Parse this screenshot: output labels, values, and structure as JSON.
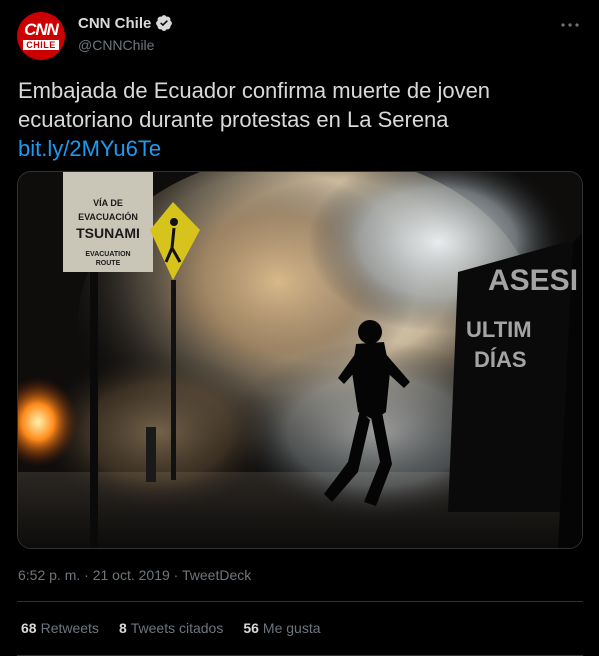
{
  "author": {
    "name": "CNN Chile",
    "handle": "@CNNChile",
    "logo_top": "CNN",
    "logo_bottom": "CHILE",
    "verified": true,
    "brand_color": "#cc0000"
  },
  "tweet": {
    "text": "Embajada de Ecuador confirma muerte de joven ecuatoriano durante protestas en La Serena",
    "link": "bit.ly/2MYu6Te",
    "link_color": "#1d9bf0"
  },
  "media": {
    "sign_lines": [
      "VÍA DE",
      "EVACUACIÓN",
      "TSUNAMI",
      "EVACUATION",
      "ROUTE"
    ],
    "graffiti_lines": [
      "ASESI",
      "ULTIM",
      "DÍAS"
    ]
  },
  "meta": {
    "time": "6:52 p. m.",
    "separator": "·",
    "date": "21 oct. 2019",
    "source": "TweetDeck"
  },
  "stats": {
    "retweets_count": "68",
    "retweets_label": "Retweets",
    "quotes_count": "8",
    "quotes_label": "Tweets citados",
    "likes_count": "56",
    "likes_label": "Me gusta"
  },
  "icons": {
    "verified": "verified-badge-icon",
    "more": "more-options-icon"
  }
}
